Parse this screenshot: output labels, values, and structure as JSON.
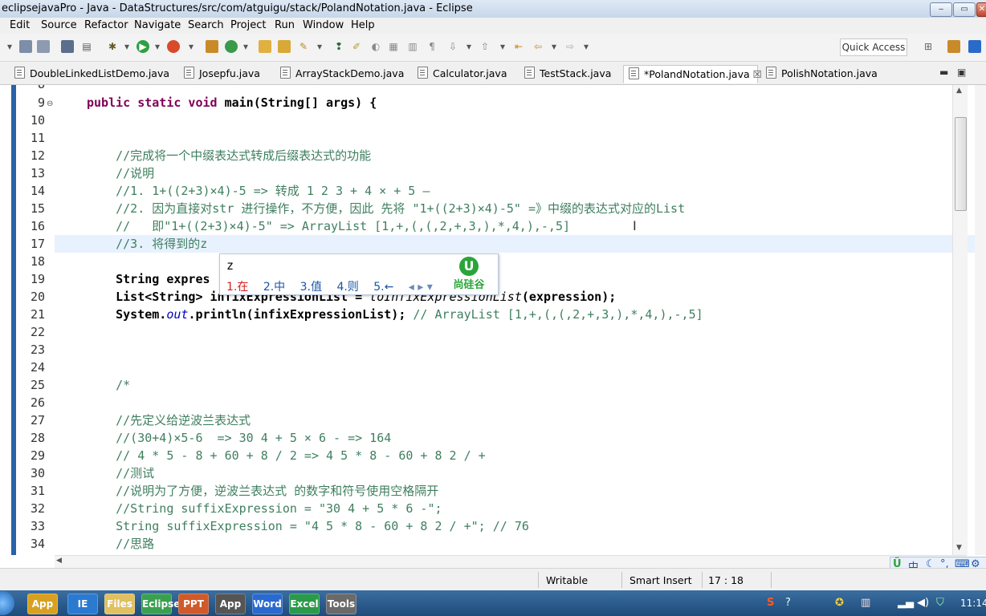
{
  "window": {
    "title": "eclipsejavaPro - Java - DataStructures/src/com/atguigu/stack/PolandNotation.java - Eclipse",
    "controls": [
      "‒",
      "▭",
      "✕"
    ]
  },
  "menu": [
    "Edit",
    "Source",
    "Refactor",
    "Navigate",
    "Search",
    "Project",
    "Run",
    "Window",
    "Help"
  ],
  "toolbar": {
    "quick_access_label": "Quick Access"
  },
  "tabs": [
    {
      "label": "DoubleLinkedListDemo.java",
      "active": false
    },
    {
      "label": "Josepfu.java",
      "active": false
    },
    {
      "label": "ArrayStackDemo.java",
      "active": false
    },
    {
      "label": "Calculator.java",
      "active": false
    },
    {
      "label": "TestStack.java",
      "active": false
    },
    {
      "label": "*PolandNotation.java",
      "active": true,
      "close": "☒"
    },
    {
      "label": "PolishNotation.java",
      "active": false
    }
  ],
  "editor": {
    "partial_line_number": "8",
    "lines": [
      {
        "n": "9",
        "segments": [
          {
            "t": "public static void ",
            "c": "kw"
          },
          {
            "t": "main(String[] args) {",
            "c": "bold"
          }
        ]
      },
      {
        "n": "10",
        "segments": []
      },
      {
        "n": "11",
        "segments": []
      },
      {
        "n": "12",
        "segments": [
          {
            "t": "    //完成将一个中缀表达式转成后缀表达式的功能",
            "c": "cm"
          }
        ]
      },
      {
        "n": "13",
        "segments": [
          {
            "t": "    //说明",
            "c": "cm"
          }
        ]
      },
      {
        "n": "14",
        "segments": [
          {
            "t": "    //1. 1+((2+3)×4)-5 => 转成 1 2 3 + 4 × + 5 –",
            "c": "cm"
          }
        ]
      },
      {
        "n": "15",
        "segments": [
          {
            "t": "    //2. 因为直接对str 进行操作，不方便，因此 先将 \"1+((2+3)×4)-5\" =》中缀的表达式对应的List",
            "c": "cm"
          }
        ]
      },
      {
        "n": "16",
        "segments": [
          {
            "t": "    //   即\"1+((2+3)×4)-5\" => ArrayList [1,+,(,(,2,+,3,),*,4,),-,5]",
            "c": "cm"
          }
        ]
      },
      {
        "n": "17",
        "segments": [
          {
            "t": "    //3. 将得到的z",
            "c": "cm"
          }
        ],
        "current": true
      },
      {
        "n": "18",
        "segments": []
      },
      {
        "n": "19",
        "segments": [
          {
            "t": "    String expres",
            "c": "bold"
          }
        ]
      },
      {
        "n": "20",
        "segments": [
          {
            "t": "    List<String> infixExpressionList = ",
            "c": "bold"
          },
          {
            "t": "toInfixExpressionList",
            "c": "ital"
          },
          {
            "t": "(expression);",
            "c": "bold"
          }
        ]
      },
      {
        "n": "21",
        "segments": [
          {
            "t": "    System.",
            "c": "bold"
          },
          {
            "t": "out",
            "c": "fld"
          },
          {
            "t": ".println(infixExpressionList); ",
            "c": "bold"
          },
          {
            "t": "// ArrayList [1,+,(,(,2,+,3,),*,4,),-,5]",
            "c": "cm"
          }
        ]
      },
      {
        "n": "22",
        "segments": []
      },
      {
        "n": "23",
        "segments": []
      },
      {
        "n": "24",
        "segments": []
      },
      {
        "n": "25",
        "segments": [
          {
            "t": "    /*",
            "c": "cm"
          }
        ]
      },
      {
        "n": "26",
        "segments": []
      },
      {
        "n": "27",
        "segments": [
          {
            "t": "    //先定义给逆波兰表达式",
            "c": "cm"
          }
        ]
      },
      {
        "n": "28",
        "segments": [
          {
            "t": "    //(30+4)×5-6  => 30 4 + 5 × 6 - => 164",
            "c": "cm"
          }
        ]
      },
      {
        "n": "29",
        "segments": [
          {
            "t": "    // 4 * 5 - 8 + 60 + 8 / 2 => 4 5 * 8 - 60 + 8 2 / +",
            "c": "cm"
          }
        ]
      },
      {
        "n": "30",
        "segments": [
          {
            "t": "    //测试",
            "c": "cm"
          }
        ]
      },
      {
        "n": "31",
        "segments": [
          {
            "t": "    //说明为了方便，逆波兰表达式 的数字和符号使用空格隔开",
            "c": "cm"
          }
        ]
      },
      {
        "n": "32",
        "segments": [
          {
            "t": "    //String suffixExpression = \"30 4 + 5 * 6 -\";",
            "c": "cm"
          }
        ]
      },
      {
        "n": "33",
        "segments": [
          {
            "t": "    String suffixExpression = \"4 5 * 8 - 60 + 8 2 / +\"; // 76",
            "c": "cm"
          }
        ]
      },
      {
        "n": "34",
        "segments": [
          {
            "t": "    //思路",
            "c": "cm"
          }
        ]
      }
    ]
  },
  "ime_popup": {
    "input": "z",
    "candidates": [
      "1.在",
      "2.中",
      "3.值",
      "4.则",
      "5.←"
    ],
    "arrows": "◂ ▸ ▾",
    "brand_mark": "U",
    "brand": "尚硅谷"
  },
  "status": {
    "writable": "Writable",
    "insert_mode": "Smart Insert",
    "position": "17 : 18"
  },
  "ime_tray": "中",
  "taskbar": {
    "clock": "11:14",
    "apps": [
      "IE",
      "Files",
      "Eclipse",
      "PPT",
      "App",
      "Word",
      "Excel",
      "Tools"
    ]
  }
}
